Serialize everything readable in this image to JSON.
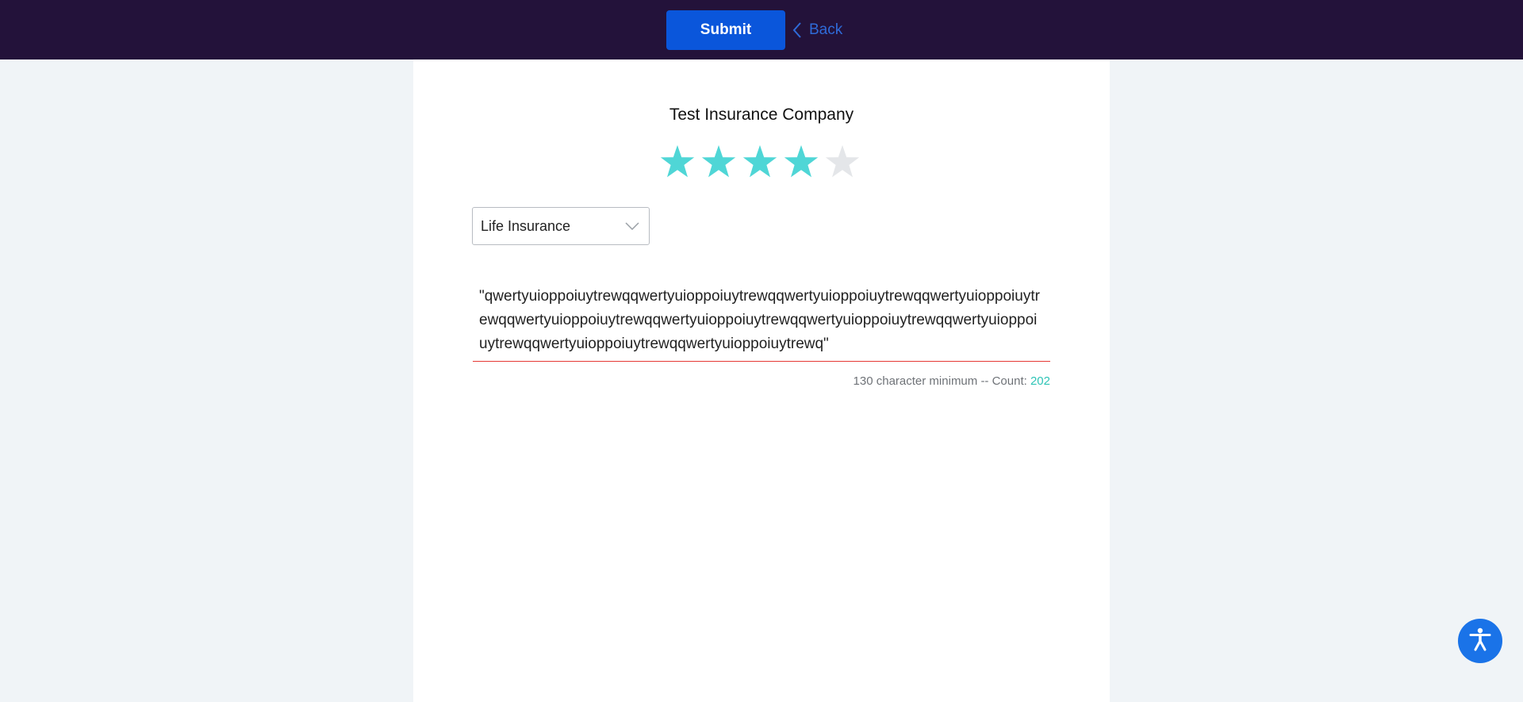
{
  "topbar": {
    "submit_label": "Submit",
    "back_label": "Back",
    "icons": {
      "back": "chevron-left-icon"
    }
  },
  "review": {
    "company_name": "Test Insurance Company",
    "rating": {
      "value": 4,
      "max": 5,
      "filled_color": "#4fd6d6",
      "empty_color": "#e4e6e9"
    },
    "category_select": {
      "selected": "Life Insurance",
      "icon": "chevron-down-icon"
    },
    "text": "\"qwertyuioppoiuytrewqqwertyuioppoiuytrewqqwertyuioppoiuytrewqqwertyuioppoiuytrewqqwertyuioppoiuytrewqqwertyuioppoiuytrewqqwertyuioppoiuytrewqqwertyuioppoiuytrewqqwertyuioppoiuytrewqqwertyuioppoiuytrewq\"",
    "min_chars_label": "130 character minimum -- Count: ",
    "count": "202"
  },
  "accessibility": {
    "icon": "accessibility-icon"
  },
  "colors": {
    "topbar": "#23123a",
    "submit": "#0a56db",
    "link": "#2f6bd9",
    "count": "#2ec4b6",
    "underline": "#e53935"
  }
}
